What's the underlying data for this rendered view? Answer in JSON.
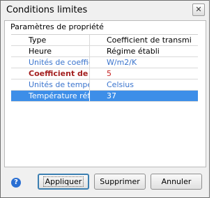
{
  "window": {
    "title": "Conditions limites",
    "close_glyph": "✕"
  },
  "group": {
    "title": "Paramètres de propriété"
  },
  "rows": [
    {
      "name": "Type",
      "value": "Coefficient de transmi"
    },
    {
      "name": "Heure",
      "value": "Régime établi"
    },
    {
      "name": "Unités de coeffici...",
      "value": "W/m2/K"
    },
    {
      "name": "Coefficient de tr...",
      "value": "5"
    },
    {
      "name": "Unités de tempéra...",
      "value": "Celsius"
    },
    {
      "name": "Température réf",
      "value": "37"
    }
  ],
  "buttons": {
    "apply": "Appliquer",
    "delete": "Supprimer",
    "cancel": "Annuler"
  },
  "icons": {
    "help": "?"
  },
  "colors": {
    "selection": "#3d8ee8",
    "unit_text": "#3a74cd",
    "required_text": "#c62020"
  }
}
